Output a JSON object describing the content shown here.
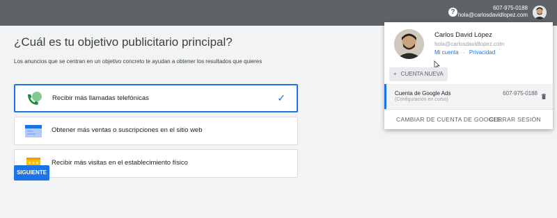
{
  "header": {
    "phone": "607-975-0188",
    "email": "hola@carlosdavidlopez.com",
    "help_icon": "help-icon"
  },
  "main": {
    "title": "¿Cuál es tu objetivo publicitario principal?",
    "subtitle": "Los anuncios que se centran en un objetivo concreto te ayudan a obtener los resultados que quieres",
    "options": [
      {
        "label": "Recibir más llamadas telefónicas",
        "icon": "phone-icon",
        "selected": true
      },
      {
        "label": "Obtener más ventas o suscripciones en el sitio web",
        "icon": "website-icon",
        "selected": false
      },
      {
        "label": "Recibir más visitas en el establecimiento físico",
        "icon": "store-icon",
        "selected": false
      }
    ],
    "next_label": "SIGUIENTE"
  },
  "dropdown": {
    "name": "Carlos David López",
    "email": "hola@carlosdavidlopez.com",
    "my_account": "Mi cuenta",
    "separator": "-",
    "privacy": "Privacidad",
    "new_account": "CUENTA NUEVA",
    "ads_account": {
      "title": "Cuenta de Google Ads",
      "status": "(Configuración en curso)",
      "phone": "607-975-0188"
    },
    "switch_account": "CAMBIAR DE CUENTA DE GOOGLE",
    "sign_out": "CERRAR SESIÓN"
  },
  "colors": {
    "header": "#5f6368",
    "accent": "#1a73e8",
    "background": "#f1f3f4"
  }
}
